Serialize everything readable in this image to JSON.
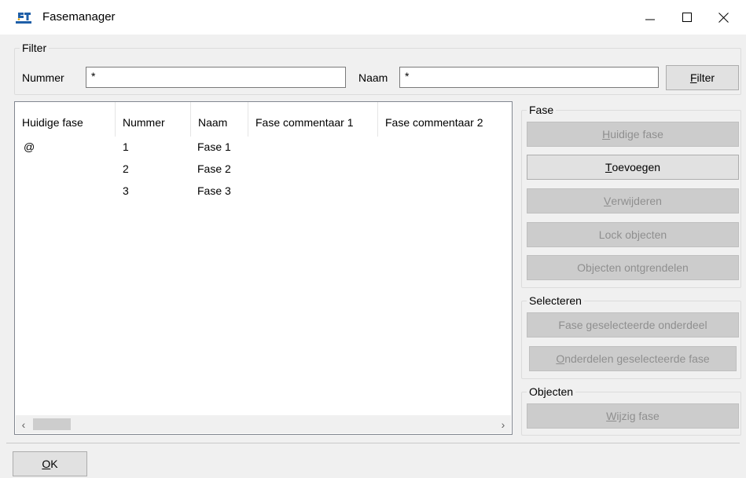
{
  "window": {
    "title": "Fasemanager",
    "icon": "fasemanager-app-icon"
  },
  "filter": {
    "legend": "Filter",
    "nummer_label": "Nummer",
    "nummer_value": "*",
    "naam_label": "Naam",
    "naam_value": "*",
    "filter_button_pre": "",
    "filter_button_key": "F",
    "filter_button_post": "ilter"
  },
  "list": {
    "columns": [
      "Huidige fase",
      "Nummer",
      "Naam",
      "Fase commentaar 1",
      "Fase commentaar 2"
    ],
    "rows": [
      {
        "current": "@",
        "number": "1",
        "name": "Fase 1"
      },
      {
        "current": "",
        "number": "2",
        "name": "Fase 2"
      },
      {
        "current": "",
        "number": "3",
        "name": "Fase 3"
      }
    ]
  },
  "fase_group": {
    "legend": "Fase",
    "huidige_pre": "",
    "huidige_key": "H",
    "huidige_post": "uidige fase",
    "toevoegen_pre": "",
    "toevoegen_key": "T",
    "toevoegen_post": "oevoegen",
    "verwijderen_pre": "",
    "verwijderen_key": "V",
    "verwijderen_post": "erwijderen",
    "lock": "Lock objecten",
    "ontgrendelen": "Objecten ontgrendelen"
  },
  "selecteren_group": {
    "legend": "Selecteren",
    "fase_onderdeel": "Fase geselecteerde onderdeel",
    "onderdelen_pre": "",
    "onderdelen_key": "O",
    "onderdelen_post": "nderdelen geselecteerde fase"
  },
  "objecten_group": {
    "legend": "Objecten",
    "wijzig_pre": "",
    "wijzig_key": "W",
    "wijzig_post": "ijzig fase"
  },
  "footer": {
    "ok_key": "O",
    "ok_post": "K"
  },
  "colors": {
    "title_bg": "#ffffff",
    "dialog_bg": "#f0f0f0",
    "disabled_text": "#8f8f8f",
    "icon_blue": "#1f5fa8"
  }
}
